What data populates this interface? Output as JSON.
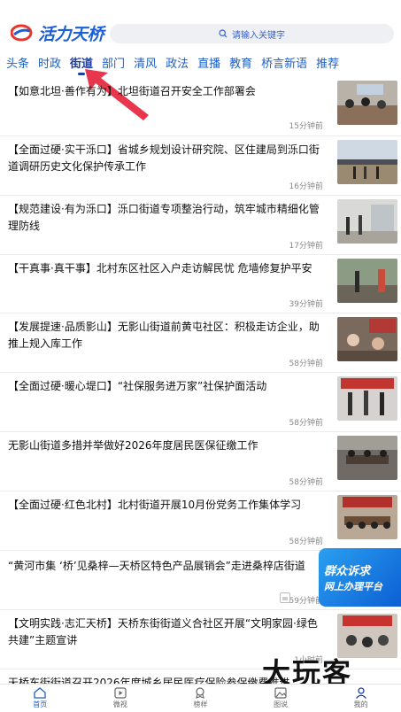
{
  "header": {
    "logo_text": "活力天桥",
    "search_placeholder": "请输入关键字"
  },
  "tabs": [
    "头条",
    "时政",
    "街道",
    "部门",
    "清风",
    "政法",
    "直播",
    "教育",
    "桥言新语",
    "推荐"
  ],
  "active_tab": "街道",
  "articles": [
    {
      "title": "【如意北坦·善作有为】北坦街道召开安全工作部署会",
      "time": "15分钟前"
    },
    {
      "title": "【全面过硬·实干泺口】省城乡规划设计研究院、区住建局到泺口街道调研历史文化保护传承工作",
      "time": "16分钟前"
    },
    {
      "title": "【规范建设·有为泺口】泺口街道专项整治行动，筑牢城市精细化管理防线",
      "time": "17分钟前"
    },
    {
      "title": "【干真事·真干事】北村东区社区入户走访解民忧  危墙修复护平安",
      "time": "39分钟前"
    },
    {
      "title": "【发展提速·品质影山】无影山街道前黄屯社区：积极走访企业，助推上规入库工作",
      "time": "58分钟前"
    },
    {
      "title": "【全面过硬·暖心堤口】“社保服务进万家”社保护面活动",
      "time": "58分钟前"
    },
    {
      "title": "无影山街道多措并举做好2026年度居民医保征缴工作",
      "time": "58分钟前"
    },
    {
      "title": "【全面过硬·红色北村】北村街道开展10月份党务工作集体学习",
      "time": "58分钟前"
    },
    {
      "title": "“黄河市集 ‘桥’见桑梓—天桥区特色产品展销会”走进桑梓店街道",
      "time": "59分钟前"
    },
    {
      "title": "【文明实践·志汇天桥】天桥东街街道义合社区开展“文明家园·绿色共建”主题宣讲",
      "time": "1小时前"
    },
    {
      "title": "天桥东街街道召开2026年度城乡居民医疗保险参保缴费推进",
      "time": ""
    }
  ],
  "float_banner": {
    "line1": "群众诉求",
    "line2": "网上办理平台"
  },
  "watermark": "大玩客",
  "bottom_nav": [
    {
      "label": "首页",
      "icon": "home-icon"
    },
    {
      "label": "微视",
      "icon": "video-icon"
    },
    {
      "label": "榜样",
      "icon": "medal-icon"
    },
    {
      "label": "图说",
      "icon": "picture-icon"
    },
    {
      "label": "我的",
      "icon": "user-icon"
    }
  ],
  "colors": {
    "accent": "#1e5fc6",
    "arrow": "#e8364d"
  }
}
